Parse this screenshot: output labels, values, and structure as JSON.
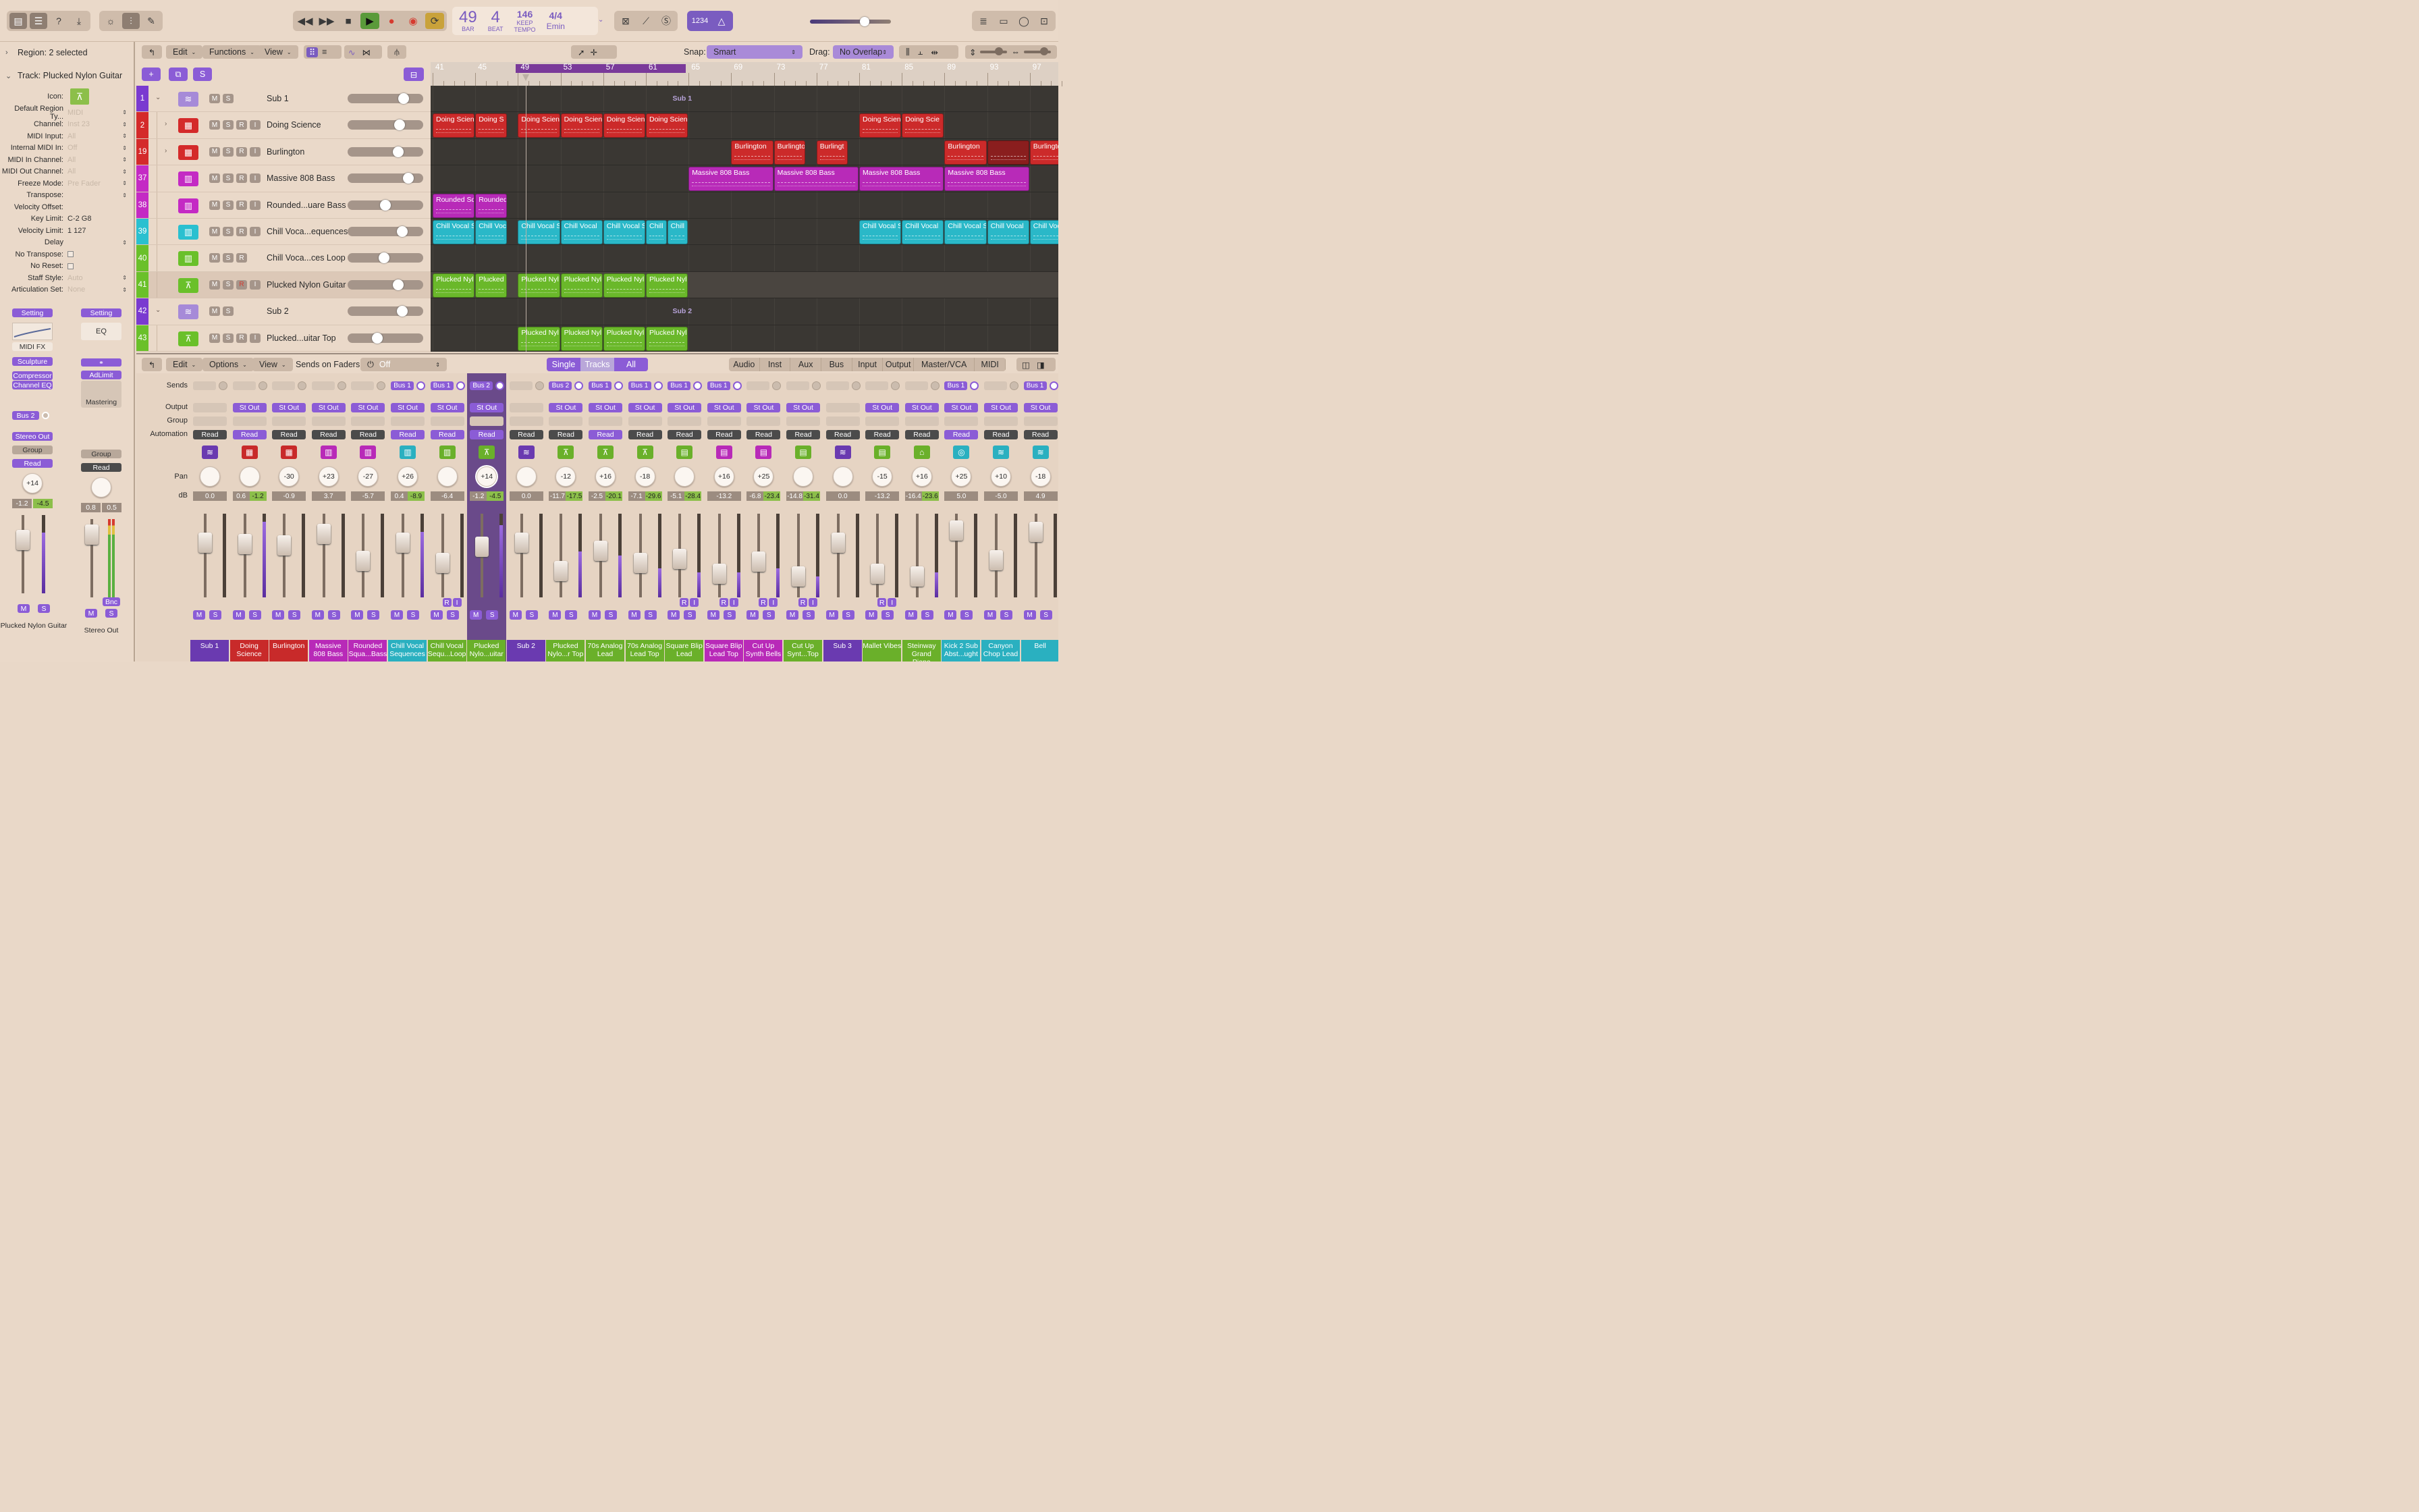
{
  "toolbar": {
    "left_icons": [
      "library-icon",
      "inspector-icon",
      "help-icon",
      "download-icon"
    ],
    "mid_icons": [
      "smart-controls-icon",
      "mixer-icon",
      "editor-pencil-icon"
    ],
    "transport_icons": [
      "rewind-icon",
      "fast-forward-icon",
      "stop-icon",
      "play-icon",
      "record-icon",
      "record-arm-icon",
      "cycle-icon"
    ],
    "lcd": {
      "bar": "49",
      "bar_label": "BAR",
      "beat": "4",
      "beat_label": "BEAT",
      "tempo": "146",
      "tempo_mode": "KEEP",
      "tempo_label": "TEMPO",
      "signature": "4/4",
      "key": "Emin"
    },
    "right_icons": [
      "replace-icon",
      "tuner-icon",
      "solo-icon"
    ],
    "count_in": "1234",
    "metronome": "metronome-icon",
    "browser_icons": [
      "list-icon",
      "notepad-icon",
      "loop-browser-icon",
      "media-browser-icon"
    ]
  },
  "inspector": {
    "region_header": "Region: 2 selected",
    "track_header": "Track:  Plucked Nylon Guitar",
    "rows": [
      {
        "label": "Icon:",
        "value": ""
      },
      {
        "label": "Default Region Ty...",
        "value": "MIDI",
        "dim": true,
        "arrows": true
      },
      {
        "label": "Channel:",
        "value": "Inst 23",
        "dim": true,
        "arrows": true
      },
      {
        "label": "MIDI Input:",
        "value": "All",
        "dim": true,
        "arrows": true
      },
      {
        "label": "Internal MIDI In:",
        "value": "Off",
        "dim": true,
        "arrows": true
      },
      {
        "label": "MIDI In Channel:",
        "value": "All",
        "dim": true,
        "arrows": true
      },
      {
        "label": "MIDI Out Channel:",
        "value": "All",
        "dim": true,
        "arrows": true
      },
      {
        "label": "Freeze Mode:",
        "value": "Pre Fader",
        "dim": true,
        "arrows": true
      },
      {
        "label": "Transpose:",
        "value": "",
        "arrows": true
      },
      {
        "label": "Velocity Offset:",
        "value": ""
      },
      {
        "label": "Key Limit:",
        "value": "C-2  G8"
      },
      {
        "label": "Velocity Limit:",
        "value": "1  127"
      },
      {
        "label": "Delay",
        "value": "",
        "arrows": true
      },
      {
        "label": "No Transpose:",
        "value": "",
        "check": true
      },
      {
        "label": "No Reset:",
        "value": "",
        "check": true
      },
      {
        "label": "Staff Style:",
        "value": "Auto",
        "dim": true,
        "arrows": true
      },
      {
        "label": "Articulation Set:",
        "value": "None",
        "dim": true,
        "arrows": true
      }
    ],
    "strip_left": {
      "setting": "Setting",
      "midi_fx": "MIDI FX",
      "plugins": [
        "Sculpture",
        "Compressor",
        "Channel EQ"
      ],
      "send": "Bus 2",
      "output": "Stereo Out",
      "group": "Group",
      "automation": "Read",
      "pan": "+14",
      "db": "-1.2",
      "peak": "-4.5",
      "mute": "M",
      "solo": "S",
      "name": "Plucked Nylon Guitar"
    },
    "strip_right": {
      "setting": "Setting",
      "eq": "EQ",
      "plugins": [
        "AdLimit"
      ],
      "mastering": "Mastering",
      "group": "Group",
      "automation": "Read",
      "db": "0.8",
      "peak": "0.5",
      "bnc": "Bnc",
      "mute": "M",
      "solo": "S",
      "name": "Stereo Out"
    }
  },
  "tracks_toolbar": {
    "edit": "Edit",
    "functions": "Functions",
    "view": "View",
    "snap_label": "Snap:",
    "snap_value": "Smart",
    "drag_label": "Drag:",
    "drag_value": "No Overlap"
  },
  "ruler": {
    "bars": [
      "41",
      "45",
      "49",
      "53",
      "57",
      "61",
      "65",
      "69",
      "73",
      "77",
      "81",
      "85",
      "89",
      "93",
      "97"
    ]
  },
  "tracks": [
    {
      "num": "1",
      "name": "Sub 1",
      "color": "#7a3ad0",
      "icon": "waveform-icon",
      "folder": true,
      "r": false,
      "vol": 0.78
    },
    {
      "num": "2",
      "name": "Doing Science",
      "color": "#d42a2a",
      "icon": "drum-machine-icon",
      "disclose": true,
      "r": true,
      "vol": 0.72
    },
    {
      "num": "19",
      "name": "Burlington",
      "color": "#d42a2a",
      "icon": "drum-machine-icon",
      "disclose": true,
      "r": true,
      "vol": 0.7
    },
    {
      "num": "37",
      "name": "Massive 808 Bass",
      "color": "#c42ac4",
      "icon": "synth-icon",
      "r": true,
      "vol": 0.85
    },
    {
      "num": "38",
      "name": "Rounded...uare Bass",
      "color": "#c42ac4",
      "icon": "synth-icon",
      "r": true,
      "vol": 0.5
    },
    {
      "num": "39",
      "name": "Chill Voca...equences",
      "color": "#2ac0d0",
      "icon": "synth-icon",
      "r": true,
      "vol": 0.76
    },
    {
      "num": "40",
      "name": "Chill Voca...ces Loop",
      "color": "#6ac02a",
      "icon": "synth-icon",
      "r": true,
      "no_i": true,
      "vol": 0.48
    },
    {
      "num": "41",
      "name": "Plucked Nylon Guitar",
      "color": "#6ac02a",
      "icon": "guitar-icon",
      "r": true,
      "sel": true,
      "vol": 0.7
    },
    {
      "num": "42",
      "name": "Sub 2",
      "color": "#7a3ad0",
      "icon": "waveform-icon",
      "folder": true,
      "r": false,
      "vol": 0.76
    },
    {
      "num": "43",
      "name": "Plucked...uitar Top",
      "color": "#6ac02a",
      "icon": "guitar-icon",
      "r": true,
      "vol": 0.38
    }
  ],
  "regions": [
    {
      "lane": 0,
      "type": "label",
      "label": "Sub 1",
      "bar": 63.5
    },
    {
      "lane": 1,
      "name": "Doing Scien",
      "start": 41,
      "end": 45,
      "color": "#cc2a2a"
    },
    {
      "lane": 1,
      "name": "Doing S",
      "start": 45,
      "end": 48,
      "color": "#cc2a2a"
    },
    {
      "lane": 1,
      "name": "Doing Scien",
      "start": 49,
      "end": 53,
      "color": "#cc2a2a"
    },
    {
      "lane": 1,
      "name": "Doing Scien",
      "start": 53,
      "end": 57,
      "color": "#cc2a2a"
    },
    {
      "lane": 1,
      "name": "Doing Scien",
      "start": 57,
      "end": 61,
      "color": "#cc2a2a"
    },
    {
      "lane": 1,
      "name": "Doing Scien",
      "start": 61,
      "end": 65,
      "color": "#cc2a2a"
    },
    {
      "lane": 1,
      "name": "Doing Scien",
      "start": 81,
      "end": 85,
      "color": "#cc2a2a"
    },
    {
      "lane": 1,
      "name": "Doing Scie",
      "start": 85,
      "end": 89,
      "color": "#cc2a2a"
    },
    {
      "lane": 2,
      "name": "Burlington",
      "start": 69,
      "end": 73,
      "color": "#cc2a2a"
    },
    {
      "lane": 2,
      "name": "Burlingto",
      "start": 73,
      "end": 76,
      "color": "#cc2a2a"
    },
    {
      "lane": 2,
      "name": "Burlingt",
      "start": 77,
      "end": 80,
      "color": "#cc2a2a"
    },
    {
      "lane": 2,
      "name": "Burlington",
      "start": 89,
      "end": 93,
      "color": "#cc2a2a"
    },
    {
      "lane": 2,
      "name": "",
      "start": 93,
      "end": 97,
      "color": "#8a1e1e"
    },
    {
      "lane": 2,
      "name": "Burlington",
      "start": 97,
      "end": 101,
      "color": "#cc2a2a"
    },
    {
      "lane": 3,
      "name": "Massive 808 Bass",
      "start": 65,
      "end": 73,
      "color": "#b82ab8"
    },
    {
      "lane": 3,
      "name": "Massive 808 Bass",
      "start": 73,
      "end": 81,
      "color": "#b82ab8"
    },
    {
      "lane": 3,
      "name": "Massive 808 Bass",
      "start": 81,
      "end": 89,
      "color": "#b82ab8"
    },
    {
      "lane": 3,
      "name": "Massive 808 Bass",
      "start": 89,
      "end": 97,
      "color": "#b82ab8"
    },
    {
      "lane": 4,
      "name": "Rounded Sq",
      "start": 41,
      "end": 45,
      "color": "#b82ab8"
    },
    {
      "lane": 4,
      "name": "Rounded",
      "start": 45,
      "end": 48,
      "color": "#b82ab8"
    },
    {
      "lane": 5,
      "name": "Chill Vocal S",
      "start": 41,
      "end": 45,
      "color": "#2ab8c8"
    },
    {
      "lane": 5,
      "name": "Chill Voc",
      "start": 45,
      "end": 48,
      "color": "#2ab8c8"
    },
    {
      "lane": 5,
      "name": "Chill Vocal S",
      "start": 49,
      "end": 53,
      "color": "#2ab8c8"
    },
    {
      "lane": 5,
      "name": "Chill Vocal",
      "start": 53,
      "end": 57,
      "color": "#2ab8c8"
    },
    {
      "lane": 5,
      "name": "Chill Vocal S",
      "start": 57,
      "end": 61,
      "color": "#2ab8c8"
    },
    {
      "lane": 5,
      "name": "Chill",
      "start": 61,
      "end": 63,
      "color": "#2ab8c8"
    },
    {
      "lane": 5,
      "name": "Chill",
      "start": 63,
      "end": 65,
      "color": "#2ab8c8"
    },
    {
      "lane": 5,
      "name": "Chill Vocal S",
      "start": 81,
      "end": 85,
      "color": "#2ab8c8"
    },
    {
      "lane": 5,
      "name": "Chill Vocal",
      "start": 85,
      "end": 89,
      "color": "#2ab8c8"
    },
    {
      "lane": 5,
      "name": "Chill Vocal S",
      "start": 89,
      "end": 93,
      "color": "#2ab8c8"
    },
    {
      "lane": 5,
      "name": "Chill Vocal",
      "start": 93,
      "end": 97,
      "color": "#2ab8c8"
    },
    {
      "lane": 5,
      "name": "Chill Vocal",
      "start": 97,
      "end": 101,
      "color": "#2ab8c8"
    },
    {
      "lane": 7,
      "name": "Plucked Nyl",
      "start": 41,
      "end": 45,
      "color": "#6ab82a"
    },
    {
      "lane": 7,
      "name": "Plucked",
      "start": 45,
      "end": 48,
      "color": "#6ab82a"
    },
    {
      "lane": 7,
      "name": "Plucked Nyl",
      "start": 49,
      "end": 53,
      "color": "#6ab82a"
    },
    {
      "lane": 7,
      "name": "Plucked Nyl",
      "start": 53,
      "end": 57,
      "color": "#6ab82a"
    },
    {
      "lane": 7,
      "name": "Plucked Nyl",
      "start": 57,
      "end": 61,
      "color": "#6ab82a"
    },
    {
      "lane": 7,
      "name": "Plucked Nyl",
      "start": 61,
      "end": 65,
      "color": "#6ab82a"
    },
    {
      "lane": 8,
      "type": "label",
      "label": "Sub 2",
      "bar": 63.5
    },
    {
      "lane": 9,
      "name": "Plucked Nyl",
      "start": 49,
      "end": 53,
      "color": "#6ab82a"
    },
    {
      "lane": 9,
      "name": "Plucked Nyl",
      "start": 53,
      "end": 57,
      "color": "#6ab82a"
    },
    {
      "lane": 9,
      "name": "Plucked Nyl",
      "start": 57,
      "end": 61,
      "color": "#6ab82a"
    },
    {
      "lane": 9,
      "name": "Plucked Nyl",
      "start": 61,
      "end": 65,
      "color": "#6ab82a"
    }
  ],
  "mixer_toolbar": {
    "edit": "Edit",
    "options": "Options",
    "view": "View",
    "sends_label": "Sends on Faders:",
    "sends_value": "Off",
    "modes": [
      "Single",
      "Tracks",
      "All"
    ],
    "active_mode": "Tracks",
    "filters": [
      "Audio",
      "Inst",
      "Aux",
      "Bus",
      "Input",
      "Output",
      "Master/VCA",
      "MIDI"
    ]
  },
  "mixer_row_labels": [
    "Sends",
    "Output",
    "Group",
    "Automation",
    "Pan",
    "dB"
  ],
  "strips": [
    {
      "name": "Sub 1",
      "color": "#6a3ab0",
      "send": "",
      "out": "",
      "auto": "Read",
      "auto_p": false,
      "pan": "",
      "db": "0.0",
      "peak": "",
      "fader": 0.72,
      "meter": 0,
      "icon": "waveform-icon"
    },
    {
      "name": "Doing Science",
      "color": "#c82a2a",
      "send": "",
      "out": "St Out",
      "auto": "Read",
      "auto_p": true,
      "pan": "",
      "db": "0.6",
      "peak": "-1.2",
      "peak_green": true,
      "fader": 0.7,
      "meter": 0.9,
      "icon": "drum-machine-icon"
    },
    {
      "name": "Burlington",
      "color": "#c82a2a",
      "send": "",
      "out": "St Out",
      "auto": "Read",
      "auto_p": false,
      "pan": "-30",
      "db": "-0.9",
      "peak": "",
      "fader": 0.68,
      "meter": 0,
      "icon": "drum-machine-icon"
    },
    {
      "name": "Massive 808 Bass",
      "color": "#b82ab8",
      "send": "",
      "out": "St Out",
      "auto": "Read",
      "auto_p": false,
      "pan": "+23",
      "db": "3.7",
      "peak": "",
      "fader": 0.85,
      "meter": 0,
      "icon": "synth-icon"
    },
    {
      "name": "Rounded Squa...Bass",
      "color": "#b82ab8",
      "send": "",
      "out": "St Out",
      "auto": "Read",
      "auto_p": false,
      "pan": "-27",
      "db": "-5.7",
      "peak": "",
      "fader": 0.45,
      "meter": 0,
      "icon": "synth-icon"
    },
    {
      "name": "Chill Vocal Sequences",
      "color": "#2ab0c0",
      "send": "Bus 1",
      "out": "St Out",
      "auto": "Read",
      "auto_p": true,
      "pan": "+26",
      "db": "0.4",
      "peak": "-8.9",
      "peak_green": true,
      "fader": 0.72,
      "meter": 0.78,
      "icon": "synth-icon"
    },
    {
      "name": "Chill Vocal Sequ...Loop",
      "color": "#6ab02a",
      "send": "Bus 1",
      "out": "St Out",
      "auto": "Read",
      "auto_p": true,
      "pan": "",
      "db": "-6.4",
      "peak": "",
      "fader": 0.42,
      "meter": 0,
      "icon": "synth-icon",
      "ri": true
    },
    {
      "name": "Plucked Nylo...uitar",
      "color": "#6ab02a",
      "send": "Bus 2",
      "out": "St Out",
      "auto": "Read",
      "auto_p": true,
      "pan": "+14",
      "db": "-1.2",
      "peak": "-4.5",
      "peak_green": true,
      "fader": 0.66,
      "meter": 0.86,
      "icon": "guitar-icon",
      "sel": true
    },
    {
      "name": "Sub 2",
      "color": "#6a3ab0",
      "send": "",
      "out": "",
      "auto": "Read",
      "auto_p": false,
      "pan": "",
      "db": "0.0",
      "peak": "",
      "fader": 0.72,
      "meter": 0,
      "icon": "waveform-icon"
    },
    {
      "name": "Plucked Nylo...r Top",
      "color": "#6ab02a",
      "send": "Bus 2",
      "out": "St Out",
      "auto": "Read",
      "auto_p": false,
      "pan": "-12",
      "db": "-11.7",
      "peak": "-17.5",
      "peak_green": true,
      "fader": 0.3,
      "meter": 0.55,
      "icon": "guitar-icon"
    },
    {
      "name": "70s Analog Lead",
      "color": "#6ab02a",
      "send": "Bus 1",
      "out": "St Out",
      "auto": "Read",
      "auto_p": true,
      "pan": "+16",
      "db": "-2.5",
      "peak": "-20.1",
      "peak_green": true,
      "fader": 0.6,
      "meter": 0.5,
      "icon": "guitar-icon"
    },
    {
      "name": "70s Analog Lead Top",
      "color": "#6ab02a",
      "send": "Bus 1",
      "out": "St Out",
      "auto": "Read",
      "auto_p": false,
      "pan": "-18",
      "db": "-7.1",
      "peak": "-29.6",
      "peak_green": true,
      "fader": 0.42,
      "meter": 0.35,
      "icon": "guitar-icon"
    },
    {
      "name": "Square Blip Lead",
      "color": "#6ab02a",
      "send": "Bus 1",
      "out": "St Out",
      "auto": "Read",
      "auto_p": false,
      "pan": "",
      "db": "-5.1",
      "peak": "-28.4",
      "peak_green": true,
      "fader": 0.48,
      "meter": 0.3,
      "icon": "keyboard-icon",
      "ri": true
    },
    {
      "name": "Square Blip Lead Top",
      "color": "#b82ab8",
      "send": "Bus 1",
      "out": "St Out",
      "auto": "Read",
      "auto_p": false,
      "pan": "+16",
      "db": "-13.2",
      "peak": "",
      "fader": 0.26,
      "meter": 0.3,
      "icon": "keyboard-icon",
      "ri": true
    },
    {
      "name": "Cut Up Synth Bells",
      "color": "#b82ab8",
      "send": "",
      "out": "St Out",
      "auto": "Read",
      "auto_p": false,
      "pan": "+25",
      "db": "-6.8",
      "peak": "-23.4",
      "peak_green": true,
      "fader": 0.44,
      "meter": 0.35,
      "icon": "keyboard-icon",
      "ri": true
    },
    {
      "name": "Cut Up Synt...Top",
      "color": "#6ab02a",
      "send": "",
      "out": "St Out",
      "auto": "Read",
      "auto_p": false,
      "pan": "",
      "db": "-14.8",
      "peak": "-31.4",
      "peak_green": true,
      "fader": 0.22,
      "meter": 0.25,
      "icon": "keyboard-icon",
      "ri": true
    },
    {
      "name": "Sub 3",
      "color": "#6a3ab0",
      "send": "",
      "out": "",
      "auto": "Read",
      "auto_p": false,
      "pan": "",
      "db": "0.0",
      "peak": "",
      "fader": 0.72,
      "meter": 0,
      "icon": "waveform-icon"
    },
    {
      "name": "Mallet Vibes",
      "color": "#6ab02a",
      "send": "",
      "out": "St Out",
      "auto": "Read",
      "auto_p": false,
      "pan": "-15",
      "db": "-13.2",
      "peak": "",
      "fader": 0.26,
      "meter": 0,
      "icon": "keyboard-icon",
      "ri": true
    },
    {
      "name": "Steinway Grand Piano",
      "color": "#6ab02a",
      "send": "",
      "out": "St Out",
      "auto": "Read",
      "auto_p": false,
      "pan": "+16",
      "db": "-16.4",
      "peak": "-23.6",
      "peak_green": true,
      "fader": 0.22,
      "meter": 0.3,
      "icon": "piano-icon"
    },
    {
      "name": "Kick 2 Sub Abst...ught",
      "color": "#2ab0c0",
      "send": "Bus 1",
      "out": "St Out",
      "auto": "Read",
      "auto_p": true,
      "pan": "+25",
      "db": "5.0",
      "peak": "",
      "fader": 0.9,
      "meter": 0,
      "icon": "drummer-icon"
    },
    {
      "name": "Canyon Chop Lead",
      "color": "#2ab0c0",
      "send": "",
      "out": "St Out",
      "auto": "Read",
      "auto_p": false,
      "pan": "+10",
      "db": "-5.0",
      "peak": "",
      "fader": 0.46,
      "meter": 0,
      "icon": "waveform-icon"
    },
    {
      "name": "Bell",
      "color": "#2ab0c0",
      "send": "Bus 1",
      "out": "St Out",
      "auto": "Read",
      "auto_p": false,
      "pan": "-18",
      "db": "4.9",
      "peak": "",
      "fader": 0.88,
      "meter": 0,
      "icon": "waveform-icon"
    }
  ],
  "strip_labels": {
    "mute": "M",
    "solo": "S",
    "r": "R",
    "i": "I"
  }
}
